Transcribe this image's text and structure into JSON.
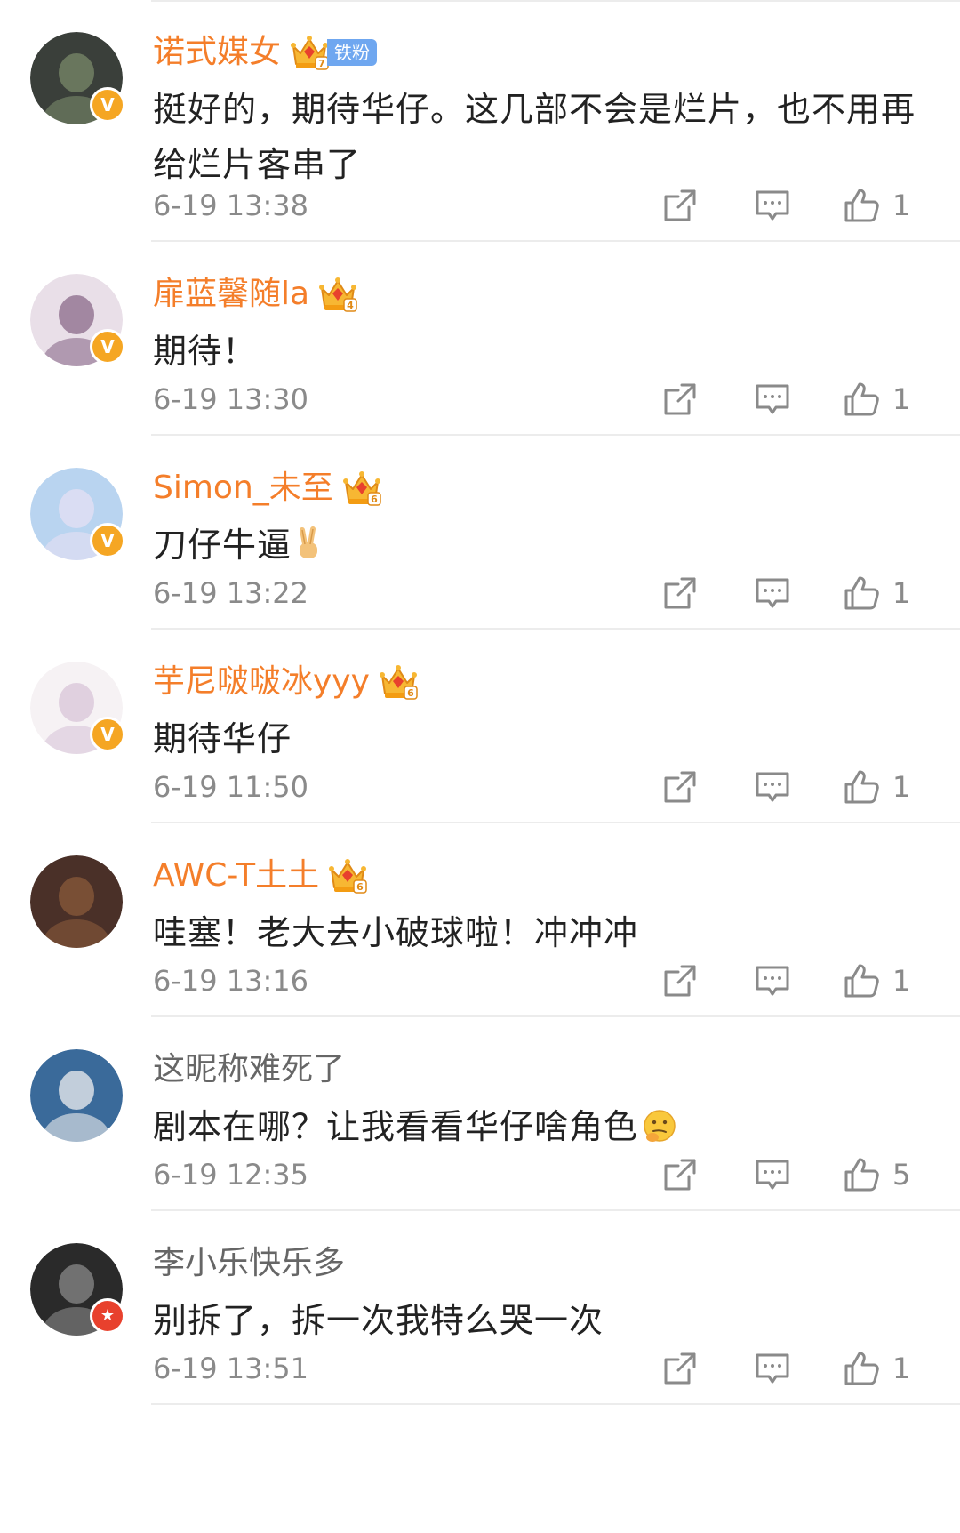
{
  "comments": [
    {
      "username": "诺式媒女",
      "vip": true,
      "crown_level": "7",
      "fan_tag": "铁粉",
      "text": "挺好的，期待华仔。这几部不会是烂片，也不用再给烂片客串了",
      "emoji": "",
      "time": "6-19 13:38",
      "likes": "1",
      "badge": "V",
      "badge_color": "#f5a623",
      "avatar_colors": [
        "#3a3f3a",
        "#7a8a6a"
      ]
    },
    {
      "username": "扉蓝馨随la",
      "vip": true,
      "crown_level": "4",
      "fan_tag": "",
      "text": "期待！",
      "emoji": "",
      "time": "6-19 13:30",
      "likes": "1",
      "badge": "V",
      "badge_color": "#f5a623",
      "avatar_colors": [
        "#e9dfe8",
        "#8a6a8a"
      ]
    },
    {
      "username": "Simon_未至",
      "vip": true,
      "crown_level": "6",
      "fan_tag": "",
      "text": "刀仔牛逼",
      "emoji": "victory-hand",
      "time": "6-19 13:22",
      "likes": "1",
      "badge": "V",
      "badge_color": "#f5a623",
      "avatar_colors": [
        "#b9d4f0",
        "#e6e0f4"
      ]
    },
    {
      "username": "芋尼啵啵冰yyy",
      "vip": true,
      "crown_level": "6",
      "fan_tag": "",
      "text": "期待华仔",
      "emoji": "",
      "time": "6-19 11:50",
      "likes": "1",
      "badge": "V",
      "badge_color": "#f5a623",
      "avatar_colors": [
        "#f6f2f4",
        "#d8c4d8"
      ]
    },
    {
      "username": "AWC-T土土",
      "vip": true,
      "crown_level": "6",
      "fan_tag": "",
      "text": "哇塞！老大去小破球啦！冲冲冲",
      "emoji": "",
      "time": "6-19 13:16",
      "likes": "1",
      "badge": "",
      "badge_color": "",
      "avatar_colors": [
        "#4a3028",
        "#8a5a3a"
      ]
    },
    {
      "username": "这昵称难死了",
      "vip": false,
      "crown_level": "",
      "fan_tag": "",
      "text": "剧本在哪？让我看看华仔啥角色",
      "emoji": "thinking-face",
      "time": "6-19 12:35",
      "likes": "5",
      "badge": "",
      "badge_color": "",
      "avatar_colors": [
        "#3a6a9a",
        "#f0f0f0"
      ]
    },
    {
      "username": "李小乐快乐多",
      "vip": false,
      "crown_level": "",
      "fan_tag": "",
      "text": "别拆了，拆一次我特么哭一次",
      "emoji": "",
      "time": "6-19 13:51",
      "likes": "1",
      "badge": "★",
      "badge_color": "#e8412d",
      "avatar_colors": [
        "#2a2a2a",
        "#8a8a8a"
      ]
    }
  ]
}
